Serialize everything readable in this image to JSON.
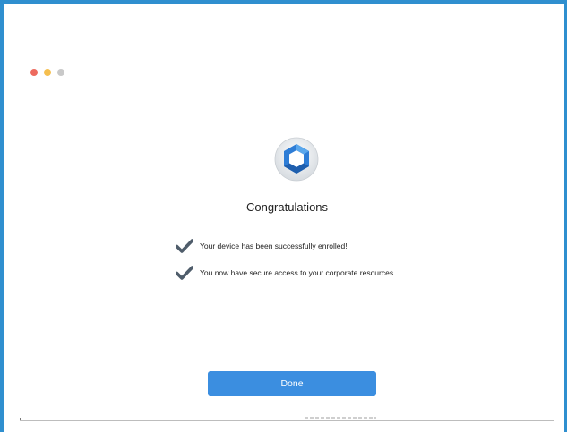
{
  "window": {
    "controls": [
      "close",
      "minimize",
      "zoom"
    ],
    "colors": {
      "border": "#2f8fcf",
      "close": "#ed6a5e",
      "minimize": "#f5bf4f",
      "zoom": "#c9c9c9"
    }
  },
  "main": {
    "logo_icon": "app-logo-icon",
    "title": "Congratulations",
    "checks": [
      {
        "icon": "checkmark-icon",
        "text": "Your device has been successfully enrolled!"
      },
      {
        "icon": "checkmark-icon",
        "text": "You now have secure access to your corporate resources."
      }
    ]
  },
  "footer": {
    "done_label": "Done",
    "button_color": "#3b8ee0"
  }
}
